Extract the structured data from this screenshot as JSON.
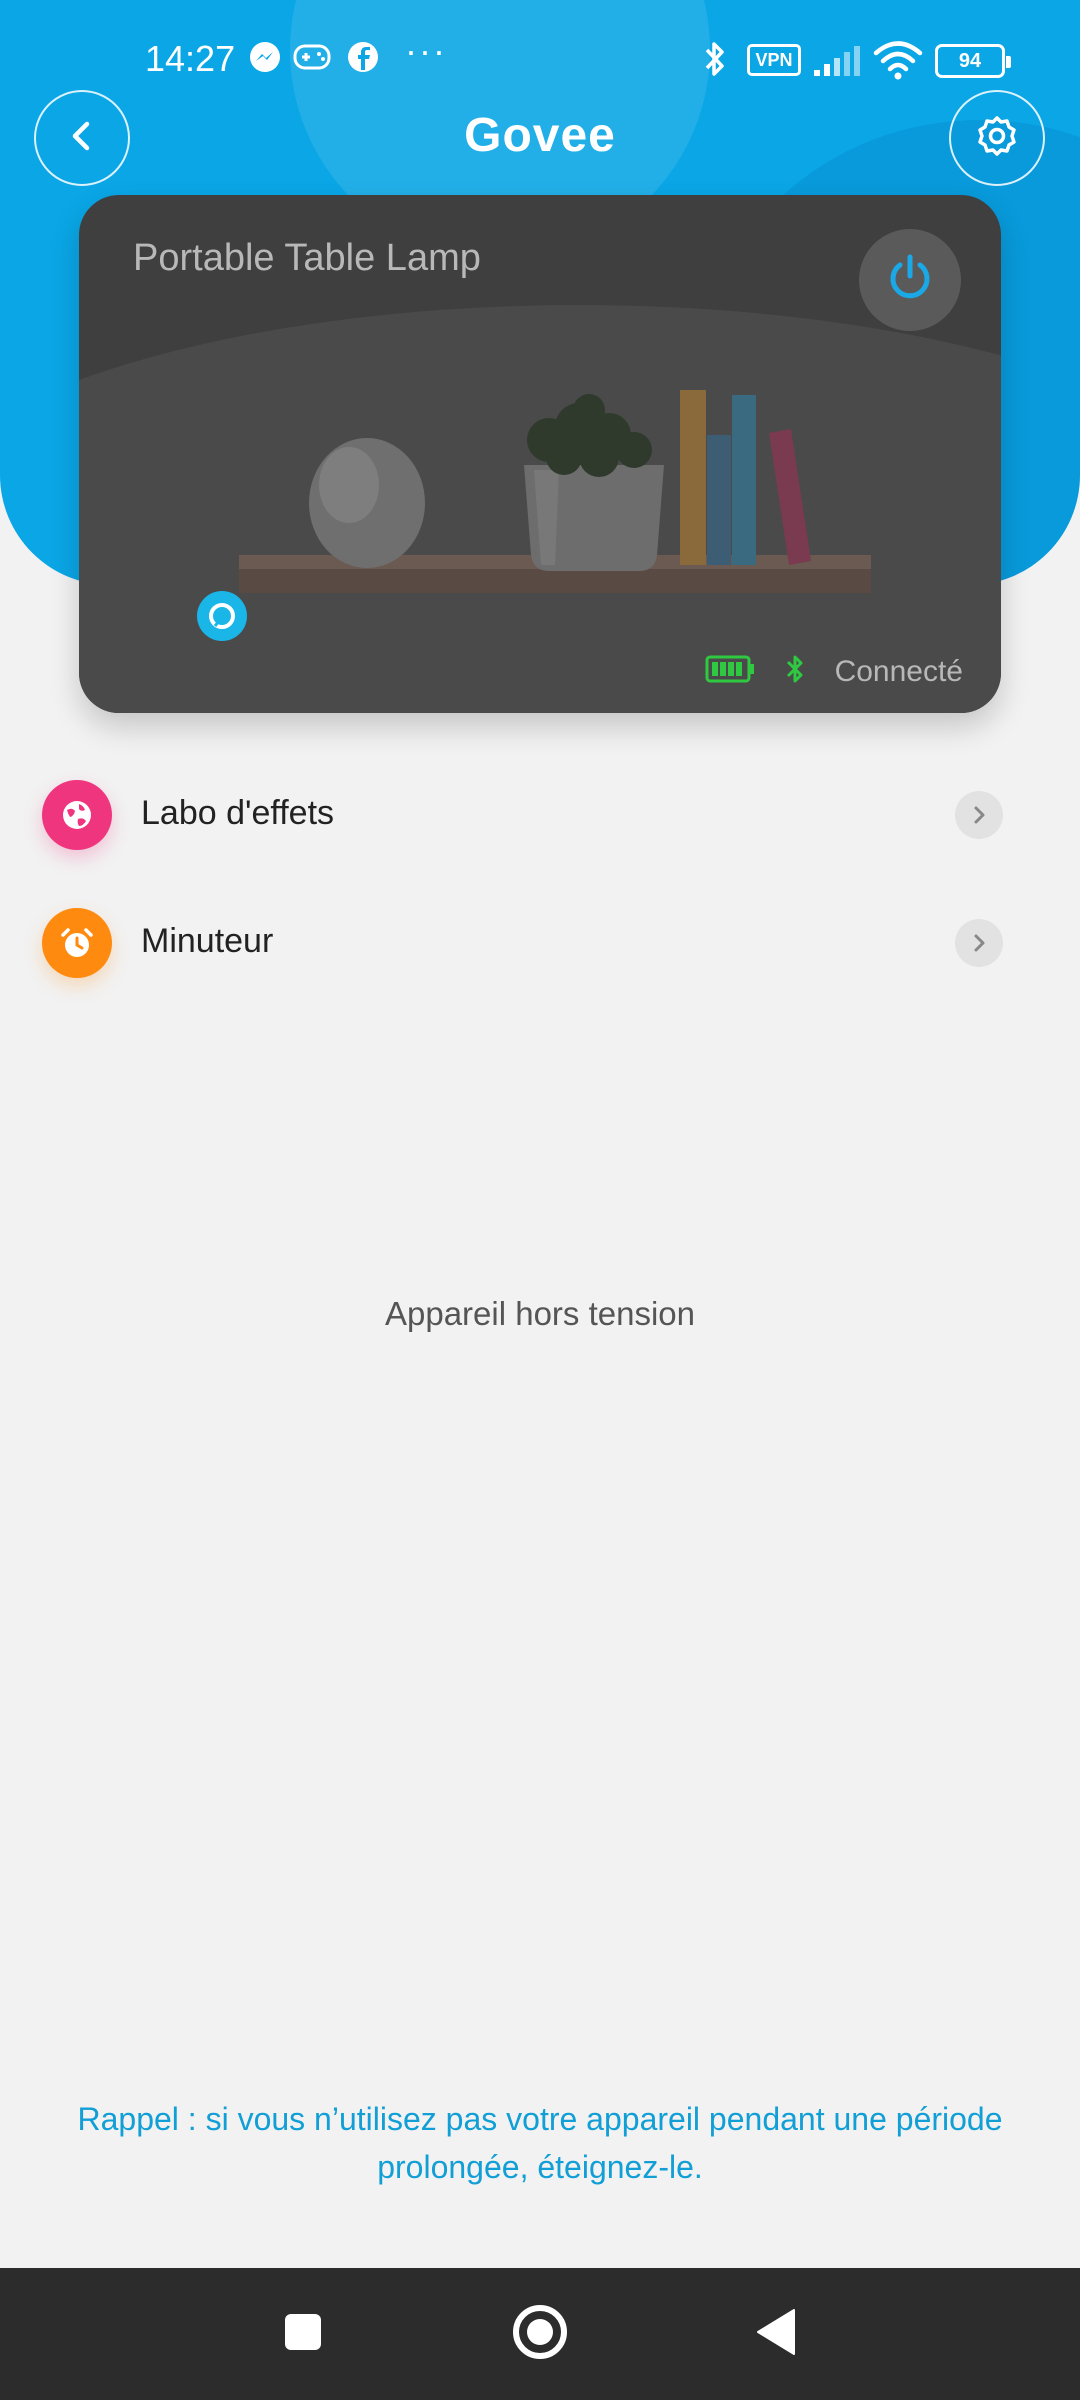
{
  "status_bar": {
    "time": "14:27",
    "vpn": "VPN",
    "battery": "94",
    "more": "···"
  },
  "header": {
    "brand": "Govee"
  },
  "device": {
    "name": "Portable Table Lamp",
    "status": "Connecté",
    "power_state": "off"
  },
  "menu": [
    {
      "label": "Labo d'effets",
      "icon": "globe-icon",
      "color": "#f0357f"
    },
    {
      "label": "Minuteur",
      "icon": "alarm-clock-icon",
      "color": "#ff8a10"
    }
  ],
  "main": {
    "off_message": "Appareil hors tension",
    "reminder": "Rappel : si vous n’utilisez pas votre appareil pendant une période prolongée, éteignez-le."
  },
  "colors": {
    "brand_blue": "#0aa6e6",
    "connected_green": "#2ec940",
    "reminder_blue": "#119fd6"
  }
}
